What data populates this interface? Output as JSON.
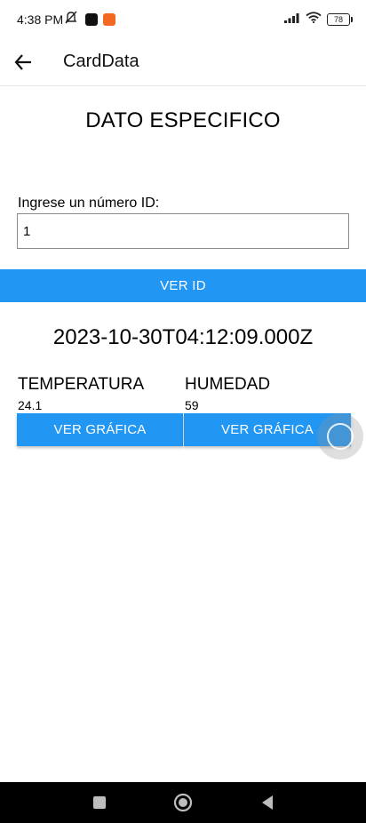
{
  "status_bar": {
    "time": "4:38 PM",
    "battery": "78",
    "icons": [
      "mute-icon",
      "app-notification-icon",
      "record-notification-icon",
      "signal-icon",
      "wifi-icon",
      "battery-icon"
    ]
  },
  "app_bar": {
    "title": "CardData",
    "back_icon": "arrow-left-icon"
  },
  "section": {
    "title": "DATO ESPECIFICO"
  },
  "id_form": {
    "label": "Ingrese un número ID:",
    "value": "1",
    "button_label": "VER ID"
  },
  "result": {
    "timestamp": "2023-10-30T04:12:09.000Z",
    "temperature": {
      "label": "TEMPERATURA",
      "value": "24.1",
      "button_label": "VER GRÁFICA"
    },
    "humidity": {
      "label": "HUMEDAD",
      "value": "59",
      "button_label": "VER GRÁFICA"
    }
  },
  "nav_bar": {
    "icons": [
      "recents-square-icon",
      "home-circle-icon",
      "back-triangle-icon"
    ]
  },
  "colors": {
    "accent": "#2196f3",
    "nav_background": "#000000"
  }
}
